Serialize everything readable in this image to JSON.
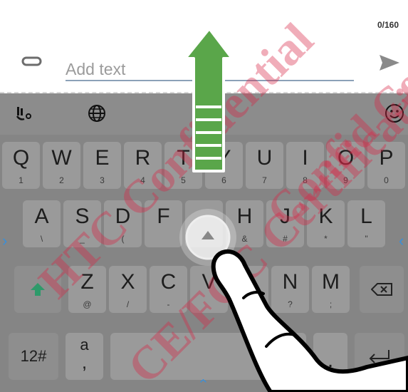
{
  "compose": {
    "counter": "0/160",
    "placeholder": "Add text"
  },
  "toolbar": {
    "icons": [
      "voice-input-icon",
      "globe-icon",
      "emoji-icon"
    ]
  },
  "keyboard": {
    "row1": [
      {
        "main": "Q",
        "sub": "1"
      },
      {
        "main": "W",
        "sub": "2"
      },
      {
        "main": "E",
        "sub": "3"
      },
      {
        "main": "R",
        "sub": "4"
      },
      {
        "main": "T",
        "sub": "5"
      },
      {
        "main": "Y",
        "sub": "6"
      },
      {
        "main": "U",
        "sub": "7"
      },
      {
        "main": "I",
        "sub": "8"
      },
      {
        "main": "O",
        "sub": "9"
      },
      {
        "main": "P",
        "sub": "0"
      }
    ],
    "row2": [
      {
        "main": "A",
        "sub": "\\"
      },
      {
        "main": "S",
        "sub": "_"
      },
      {
        "main": "D",
        "sub": "("
      },
      {
        "main": "F",
        "sub": ""
      },
      {
        "main": "",
        "sub": ""
      },
      {
        "main": "H",
        "sub": "&"
      },
      {
        "main": "J",
        "sub": "#"
      },
      {
        "main": "K",
        "sub": "*"
      },
      {
        "main": "L",
        "sub": "\""
      }
    ],
    "row3": [
      {
        "main": "Z",
        "sub": "@"
      },
      {
        "main": "X",
        "sub": "/"
      },
      {
        "main": "C",
        "sub": "-"
      },
      {
        "main": "V",
        "sub": ""
      },
      {
        "main": "",
        "sub": ""
      },
      {
        "main": "N",
        "sub": "?"
      },
      {
        "main": "M",
        "sub": ";"
      }
    ],
    "row4": {
      "symbols_label": "12#",
      "punct_top": "a",
      "punct_bottom": ","
    }
  },
  "watermark": {
    "line1": "HTC Confidential",
    "line2": "CE/FCC Certification",
    "line3": "Confid Certi"
  },
  "colors": {
    "swipe_arrow": "#5aa64a",
    "watermark": "#d7284a",
    "shift_arrow": "#2e9a6a"
  }
}
